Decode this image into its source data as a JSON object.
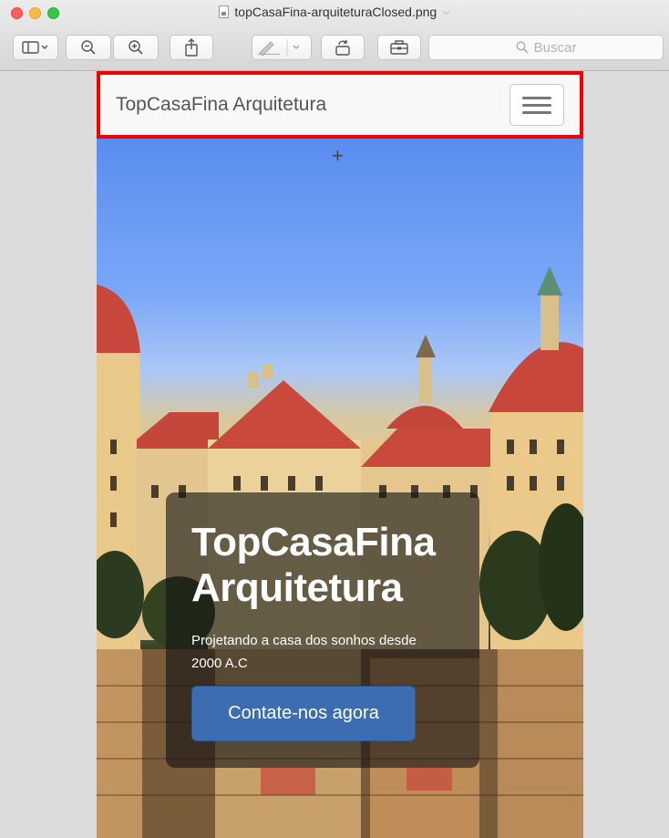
{
  "window": {
    "title": "topCasaFina-arquiteturaClosed.png",
    "search_placeholder": "Buscar"
  },
  "navbar": {
    "brand": "TopCasaFina Arquitetura",
    "highlight_color": "#f40000"
  },
  "hero": {
    "title": "TopCasaFina Arquitetura",
    "subtitle": "Projetando a casa dos sonhos desde 2000 A.C",
    "cta_label": "Contate-nos agora",
    "cta_color": "#3c6db0"
  },
  "icons": [
    "sidebar-icon",
    "zoom-out-icon",
    "zoom-in-icon",
    "share-icon",
    "markup-icon",
    "rotate-icon",
    "toolbox-icon",
    "search-icon",
    "hamburger-icon",
    "crosshair-icon"
  ]
}
